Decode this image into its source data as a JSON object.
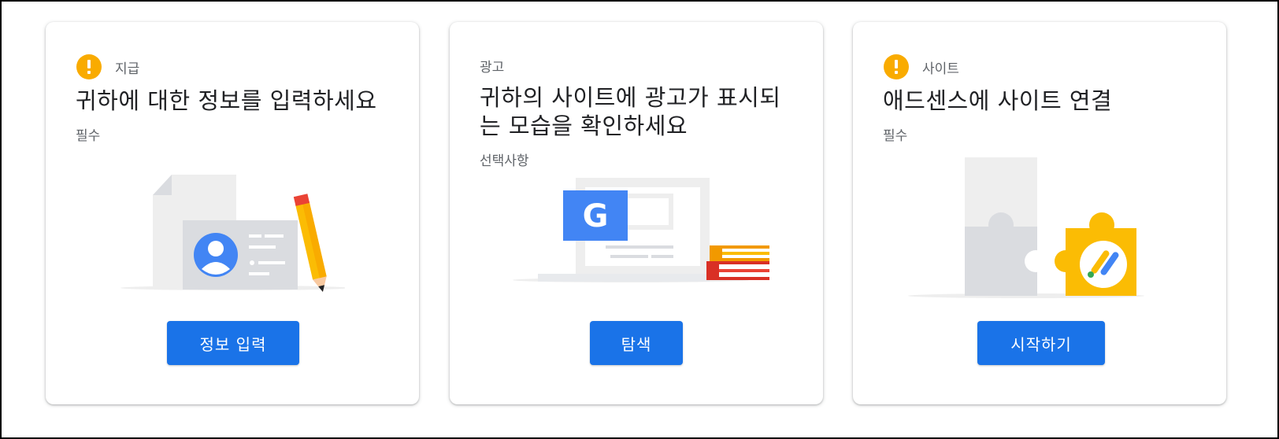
{
  "cards": [
    {
      "icon": "warning-icon",
      "eyebrow": "지급",
      "title": "귀하에 대한 정보를 입력하세요",
      "subtitle": "필수",
      "illustration": "id-card-illustration",
      "button_label": "정보 입력"
    },
    {
      "icon": null,
      "eyebrow": "광고",
      "title": "귀하의 사이트에 광고가 표시되는 모습을 확인하세요",
      "subtitle": "선택사항",
      "illustration": "laptop-google-ads-illustration",
      "button_label": "탐색"
    },
    {
      "icon": "warning-icon",
      "eyebrow": "사이트",
      "title": "애드센스에 사이트 연결",
      "subtitle": "필수",
      "illustration": "puzzle-adsense-illustration",
      "button_label": "시작하기"
    }
  ],
  "colors": {
    "primary_button": "#1a73e8",
    "warning": "#f9ab00",
    "secondary_text": "#5f6368"
  }
}
